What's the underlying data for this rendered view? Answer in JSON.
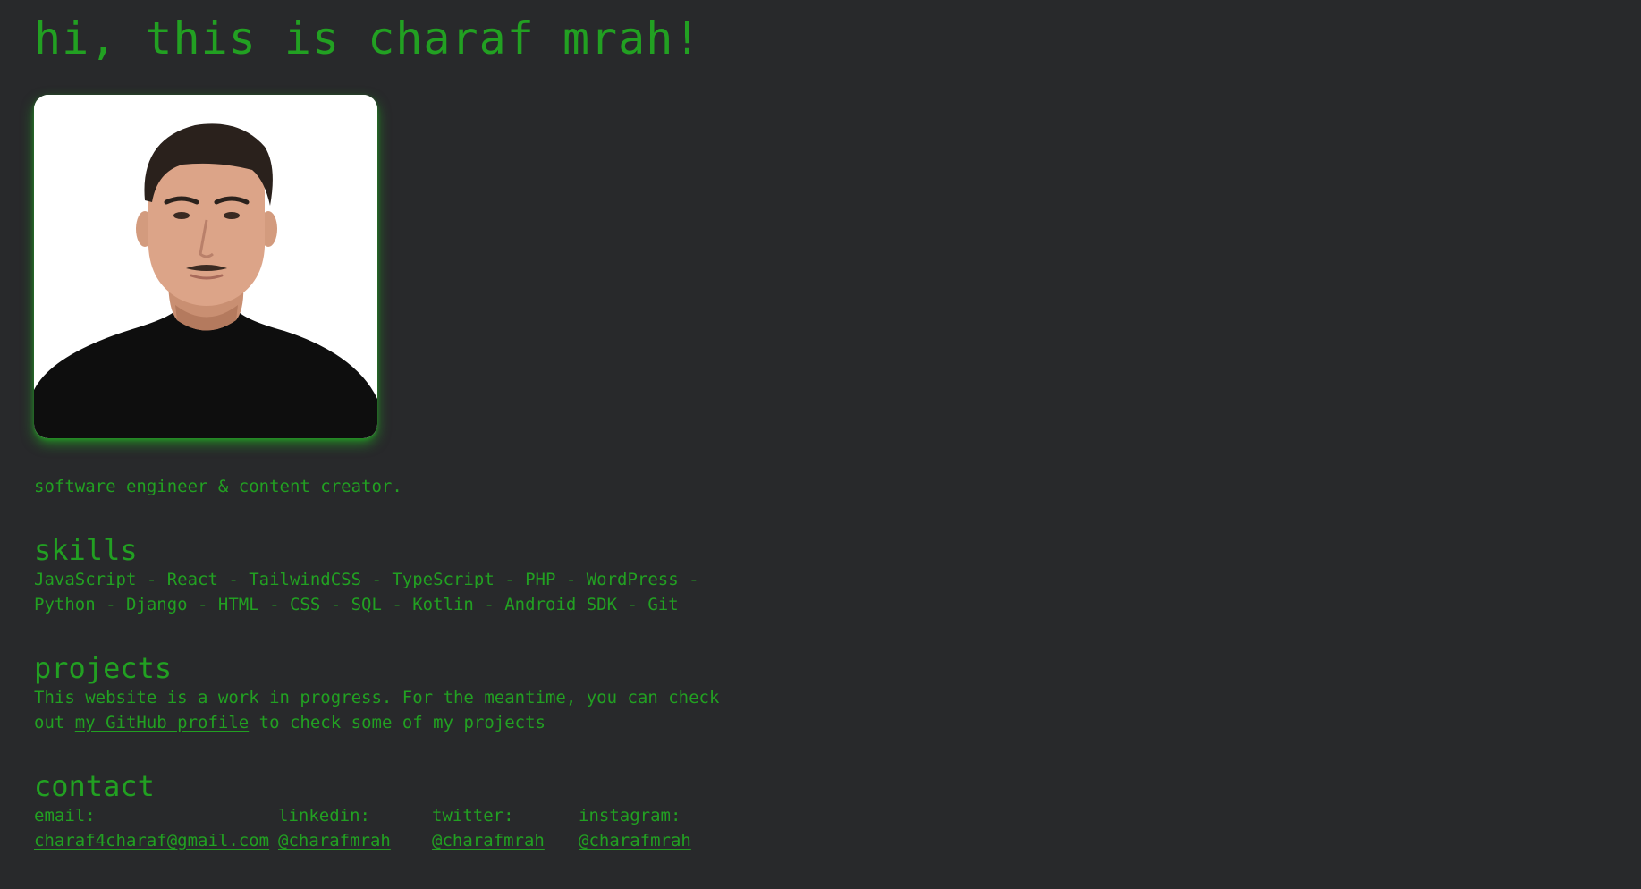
{
  "header": {
    "title": "hi, this is charaf mrah!"
  },
  "profile": {
    "photo_alt": "portrait photo",
    "tagline": "software engineer & content creator."
  },
  "skills": {
    "title": "skills",
    "text": "JavaScript - React - TailwindCSS - TypeScript - PHP - WordPress - Python - Django - HTML - CSS - SQL - Kotlin - Android SDK - Git"
  },
  "projects": {
    "title": "projects",
    "text_before": "This website is a work in progress. For the meantime, you can check out ",
    "link_label": "my GitHub profile",
    "text_after": " to check some of my projects"
  },
  "contact": {
    "title": "contact",
    "items": [
      {
        "label": "email:",
        "value": "charaf4charaf@gmail.com"
      },
      {
        "label": "linkedin:",
        "value": "@charafmrah"
      },
      {
        "label": "twitter:",
        "value": "@charafmrah"
      },
      {
        "label": "instagram:",
        "value": "@charafmrah"
      }
    ]
  },
  "colors": {
    "background": "#28292b",
    "accent": "#22a022"
  }
}
